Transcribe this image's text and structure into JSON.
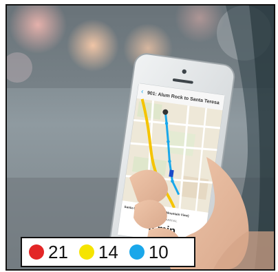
{
  "phone_screen": {
    "route_title": "901: Alum Rock to Santa Teresa",
    "stop_name": "Santa Clara (To: Alum Rock/Mountain View)",
    "arrival_label": "ESTIMATED ARRIVAL",
    "arrival_time": "8 min"
  },
  "legend": {
    "items": [
      {
        "color": "#e32626",
        "value": "21"
      },
      {
        "color": "#f5e400",
        "value": "14"
      },
      {
        "color": "#1aa7ea",
        "value": "10"
      }
    ]
  }
}
